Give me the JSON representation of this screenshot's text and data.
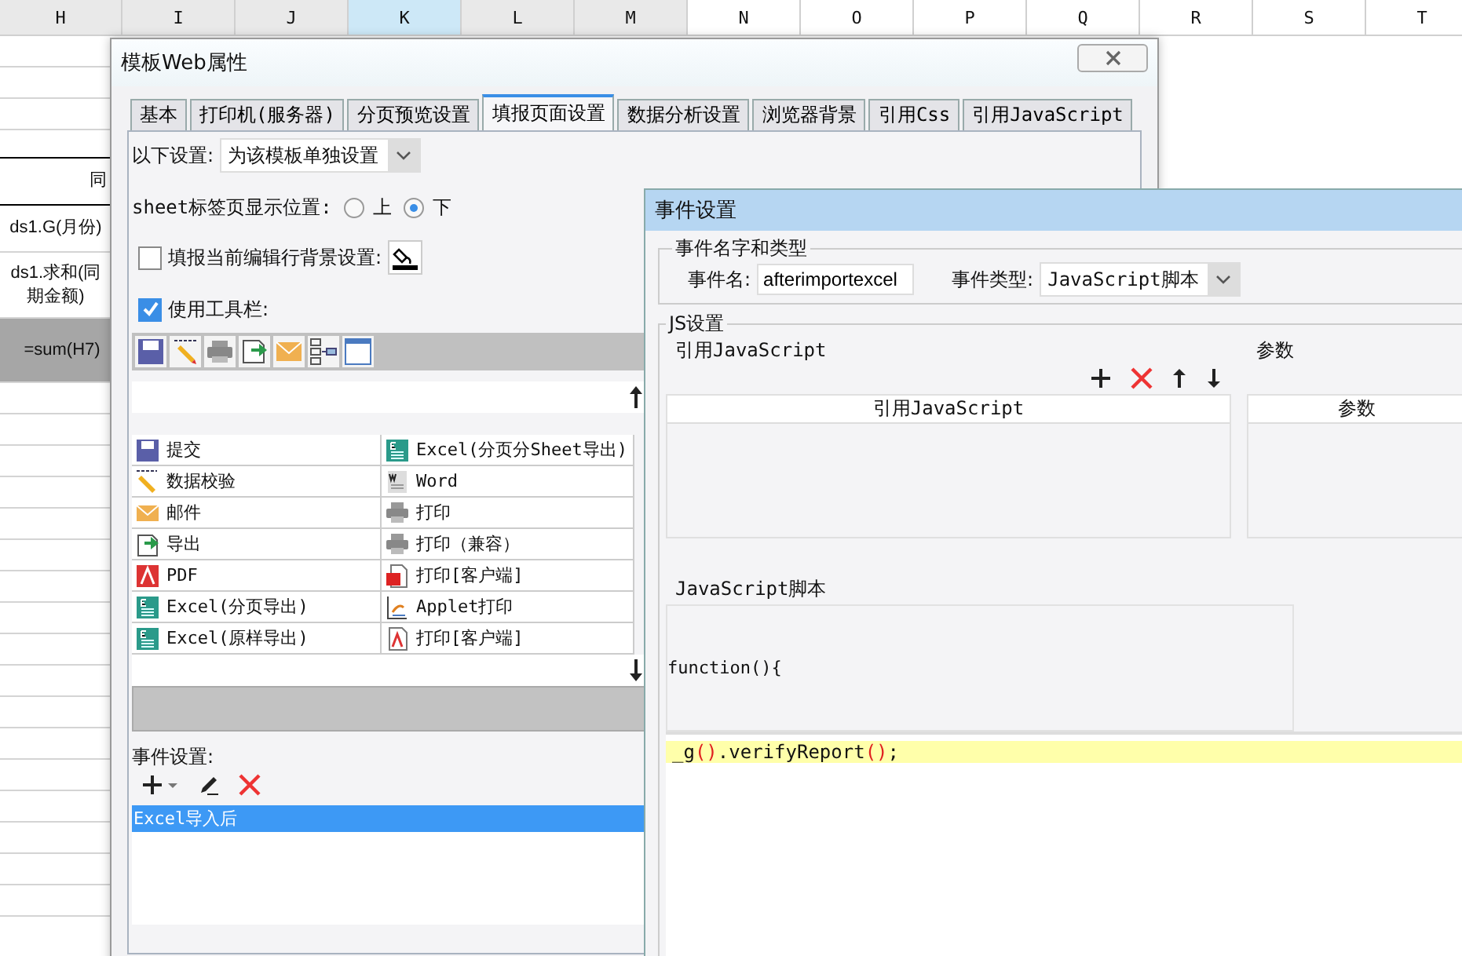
{
  "spreadsheet": {
    "columns": [
      {
        "label": "H",
        "selected": false
      },
      {
        "label": "I",
        "selected": false
      },
      {
        "label": "J",
        "selected": false
      },
      {
        "label": "K",
        "selected": true
      },
      {
        "label": "L",
        "selected": false
      },
      {
        "label": "M",
        "selected": false
      },
      {
        "label": "N",
        "selected": false
      },
      {
        "label": "O",
        "selected": false
      },
      {
        "label": "P",
        "selected": false
      },
      {
        "label": "Q",
        "selected": false
      },
      {
        "label": "R",
        "selected": false
      },
      {
        "label": "S",
        "selected": false
      },
      {
        "label": "T",
        "selected": false
      }
    ],
    "cells": [
      {
        "text": "同",
        "kind": "header"
      },
      {
        "text": "ds1.G(月份)",
        "kind": "plain"
      },
      {
        "text": "ds1.求和(同期金额)",
        "kind": "plain"
      },
      {
        "text": "=sum(H7)",
        "kind": "formula"
      }
    ]
  },
  "template_dialog": {
    "title": "模板Web属性",
    "tabs": [
      {
        "label": "基本",
        "selected": false
      },
      {
        "label": "打印机(服务器)",
        "selected": false
      },
      {
        "label": "分页预览设置",
        "selected": false
      },
      {
        "label": "填报页面设置",
        "selected": true
      },
      {
        "label": "数据分析设置",
        "selected": false
      },
      {
        "label": "浏览器背景",
        "selected": false
      },
      {
        "label": "引用Css",
        "selected": false
      },
      {
        "label": "引用JavaScript",
        "selected": false
      }
    ],
    "scope": {
      "label": "以下设置:",
      "value": "为该模板单独设置"
    },
    "sheet_tab_position": {
      "label": "sheet标签页显示位置:",
      "options": [
        {
          "label": "上",
          "selected": false
        },
        {
          "label": "下",
          "selected": true
        }
      ]
    },
    "row_background": {
      "label": "填报当前编辑行背景设置:",
      "checked": false
    },
    "use_toolbar": {
      "label": "使用工具栏:",
      "checked": true
    },
    "available_buttons": [
      {
        "label": "提交",
        "kind": "save"
      },
      {
        "label": "数据校验",
        "kind": "check"
      },
      {
        "label": "邮件",
        "kind": "mail"
      },
      {
        "label": "导出",
        "kind": "export"
      },
      {
        "label": "PDF",
        "kind": "pdf"
      },
      {
        "label": "Excel(分页导出)",
        "kind": "excel"
      },
      {
        "label": "Excel(原样导出)",
        "kind": "excel"
      },
      {
        "label": "Excel(分页分Sheet导出)",
        "kind": "excel"
      },
      {
        "label": "Word",
        "kind": "word"
      },
      {
        "label": "打印",
        "kind": "print"
      },
      {
        "label": "打印（兼容）",
        "kind": "print"
      },
      {
        "label": "打印[客户端]",
        "kind": "flash"
      },
      {
        "label": "Applet打印",
        "kind": "applet"
      },
      {
        "label": "打印[客户端]",
        "kind": "pdfdoc"
      }
    ],
    "events": {
      "label": "事件设置:",
      "items": [
        {
          "label": "Excel导入后",
          "selected": true
        }
      ]
    }
  },
  "event_dialog": {
    "title": "事件设置",
    "name_type": {
      "legend": "事件名字和类型",
      "name_label": "事件名:",
      "name_value": "afterimportexcel",
      "type_label": "事件类型:",
      "type_value": "JavaScript脚本"
    },
    "js": {
      "legend": "JS设置",
      "ref_section": "引用JavaScript",
      "ref_column": "引用JavaScript",
      "param_section": "参数",
      "param_column": "参数",
      "script_section": "JavaScript脚本",
      "script_head": "function(){",
      "code": [
        {
          "text": "_g",
          "kind": "plain"
        },
        {
          "text": "()",
          "kind": "paren"
        },
        {
          "text": ".verifyReport",
          "kind": "plain"
        },
        {
          "text": "()",
          "kind": "paren"
        },
        {
          "text": ";",
          "kind": "plain"
        }
      ]
    }
  }
}
